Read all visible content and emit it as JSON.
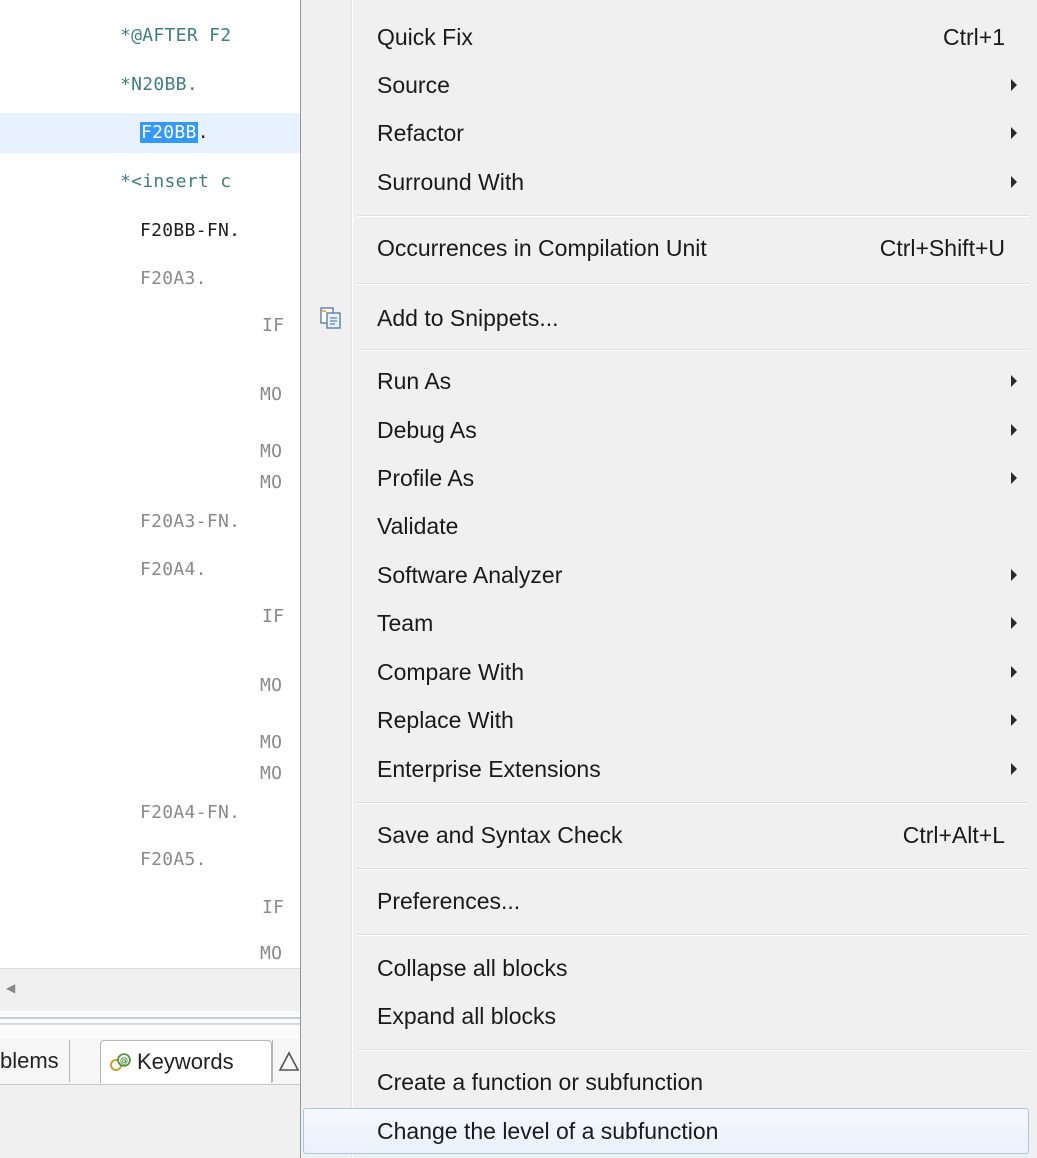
{
  "editor": {
    "lines": [
      {
        "text": "*@AFTER F2",
        "style": "comment",
        "indent": 1
      },
      {
        "text": "*N20BB.",
        "style": "comment",
        "indent": 1
      },
      {
        "text": "F20BB",
        "suffix": ".",
        "style": "normal",
        "indent": 2,
        "selected": true
      },
      {
        "text": "*<insert c",
        "style": "comment",
        "indent": 1
      },
      {
        "text": "F20BB-FN.",
        "style": "normal",
        "indent": 2
      },
      {
        "text": "F20A3.",
        "style": "faded",
        "indent": 2
      },
      {
        "text": "IF",
        "style": "faded",
        "indent": 3
      },
      {
        "text": "MO",
        "style": "faded",
        "indent": 3
      },
      {
        "text": "MO",
        "style": "faded",
        "indent": 3
      },
      {
        "text": "MO",
        "style": "faded",
        "indent": 3
      },
      {
        "text": "F20A3-FN.",
        "style": "faded",
        "indent": 2
      },
      {
        "text": "F20A4.",
        "style": "faded",
        "indent": 2
      },
      {
        "text": "IF",
        "style": "faded",
        "indent": 3
      },
      {
        "text": "MO",
        "style": "faded",
        "indent": 3
      },
      {
        "text": "MO",
        "style": "faded",
        "indent": 3
      },
      {
        "text": "MO",
        "style": "faded",
        "indent": 3
      },
      {
        "text": "F20A4-FN.",
        "style": "faded",
        "indent": 2
      },
      {
        "text": "F20A5.",
        "style": "faded",
        "indent": 2
      },
      {
        "text": "IF",
        "style": "faded",
        "indent": 3
      },
      {
        "text": "MO",
        "style": "faded",
        "indent": 3
      }
    ]
  },
  "bottom_tabs": {
    "problems_label": "blems",
    "keywords_label": "Keywords"
  },
  "context_menu": {
    "items": [
      {
        "label": "Quick Fix",
        "shortcut": "Ctrl+1"
      },
      {
        "label": "Source",
        "submenu": true
      },
      {
        "label": "Refactor",
        "submenu": true
      },
      {
        "label": "Surround With",
        "submenu": true
      },
      {
        "label": "Occurrences in Compilation Unit",
        "shortcut": "Ctrl+Shift+U"
      },
      {
        "label": "Add to Snippets...",
        "icon": "snippet-icon"
      },
      {
        "label": "Run As",
        "submenu": true
      },
      {
        "label": "Debug As",
        "submenu": true
      },
      {
        "label": "Profile As",
        "submenu": true
      },
      {
        "label": "Validate"
      },
      {
        "label": "Software Analyzer",
        "submenu": true
      },
      {
        "label": "Team",
        "submenu": true
      },
      {
        "label": "Compare With",
        "submenu": true
      },
      {
        "label": "Replace With",
        "submenu": true
      },
      {
        "label": "Enterprise Extensions",
        "submenu": true
      },
      {
        "label": "Save and Syntax Check",
        "shortcut": "Ctrl+Alt+L"
      },
      {
        "label": "Preferences..."
      },
      {
        "label": "Collapse all blocks"
      },
      {
        "label": "Expand all blocks"
      },
      {
        "label": "Create a function or subfunction"
      },
      {
        "label": "Change the level of a subfunction",
        "hovered": true
      }
    ]
  },
  "colors": {
    "selection": "#3399ff",
    "current_line": "#e8f2fe",
    "comment_text": "#3f7f7f",
    "menu_background": "#f0f0f0",
    "menu_hover_border": "#a9c8ec"
  }
}
